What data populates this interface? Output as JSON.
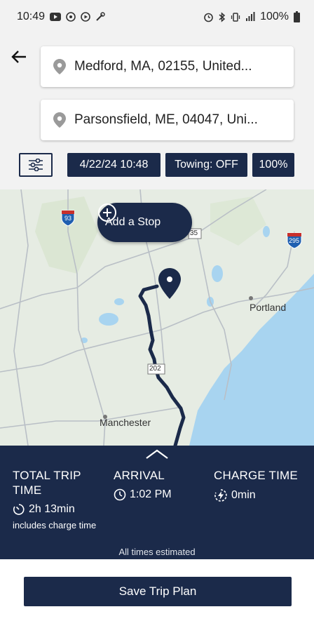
{
  "status_bar": {
    "time": "10:49",
    "battery": "100%"
  },
  "origin": {
    "text": "Medford, MA, 02155, United..."
  },
  "destination": {
    "text": "Parsonsfield, ME, 04047, Uni..."
  },
  "chips": {
    "date": "4/22/24 10:48",
    "towing": "Towing: OFF",
    "charge": "100%"
  },
  "map": {
    "add_stop_label": "Add a Stop",
    "labels": {
      "portland": "Portland",
      "manchester": "Manchester"
    },
    "shields": {
      "i93": "93",
      "i295": "295",
      "r35": "35",
      "r202": "202"
    }
  },
  "summary": {
    "total_trip": {
      "label": "TOTAL TRIP TIME",
      "value": "2h 13min",
      "note": "includes charge time"
    },
    "arrival": {
      "label": "ARRIVAL",
      "value": "1:02 PM"
    },
    "charge_time": {
      "label": "CHARGE TIME",
      "value": "0min"
    },
    "estimated_note": "All times estimated"
  },
  "save_button": {
    "label": "Save Trip Plan"
  },
  "colors": {
    "navy": "#1b2a4a",
    "water": "#a8d4f0",
    "land": "#e6ece3"
  }
}
